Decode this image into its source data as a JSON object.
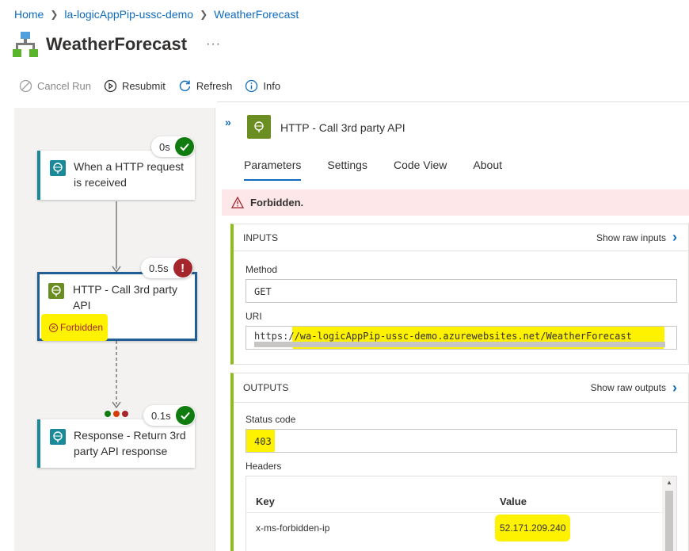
{
  "breadcrumb": {
    "items": [
      "Home",
      "la-logicAppPip-ussc-demo",
      "WeatherForecast"
    ]
  },
  "page": {
    "title": "WeatherForecast",
    "more": "···"
  },
  "toolbar": {
    "cancel_run": "Cancel Run",
    "resubmit": "Resubmit",
    "refresh": "Refresh",
    "info": "Info"
  },
  "canvas": {
    "steps": [
      {
        "label_line1": "When a HTTP request",
        "label_line2": "is received",
        "duration": "0s",
        "status": "success"
      },
      {
        "label_line1": "HTTP - Call 3rd party",
        "label_line2": "API",
        "duration": "0.5s",
        "status": "failed",
        "error": "Forbidden"
      },
      {
        "label_line1": "Response - Return 3rd",
        "label_line2": "party API response",
        "duration": "0.1s",
        "status": "success"
      }
    ]
  },
  "pane": {
    "title": "HTTP - Call 3rd party API",
    "tabs": [
      "Parameters",
      "Settings",
      "Code View",
      "About"
    ],
    "error_message": "Forbidden.",
    "inputs": {
      "heading": "INPUTS",
      "raw_link": "Show raw inputs",
      "method_label": "Method",
      "method_value": "GET",
      "uri_label": "URI",
      "uri_value": "https://wa-logicAppPip-ussc-demo.azurewebsites.net/WeatherForecast"
    },
    "outputs": {
      "heading": "OUTPUTS",
      "raw_link": "Show raw outputs",
      "status_label": "Status code",
      "status_value": "403",
      "headers_label": "Headers",
      "col_key": "Key",
      "col_value": "Value",
      "rows": [
        {
          "key": "x-ms-forbidden-ip",
          "value": "52.171.209.240"
        }
      ]
    }
  },
  "colors": {
    "link": "#0f6cbd",
    "success": "#107c10",
    "error": "#a4262c",
    "highlight": "#fff200"
  }
}
